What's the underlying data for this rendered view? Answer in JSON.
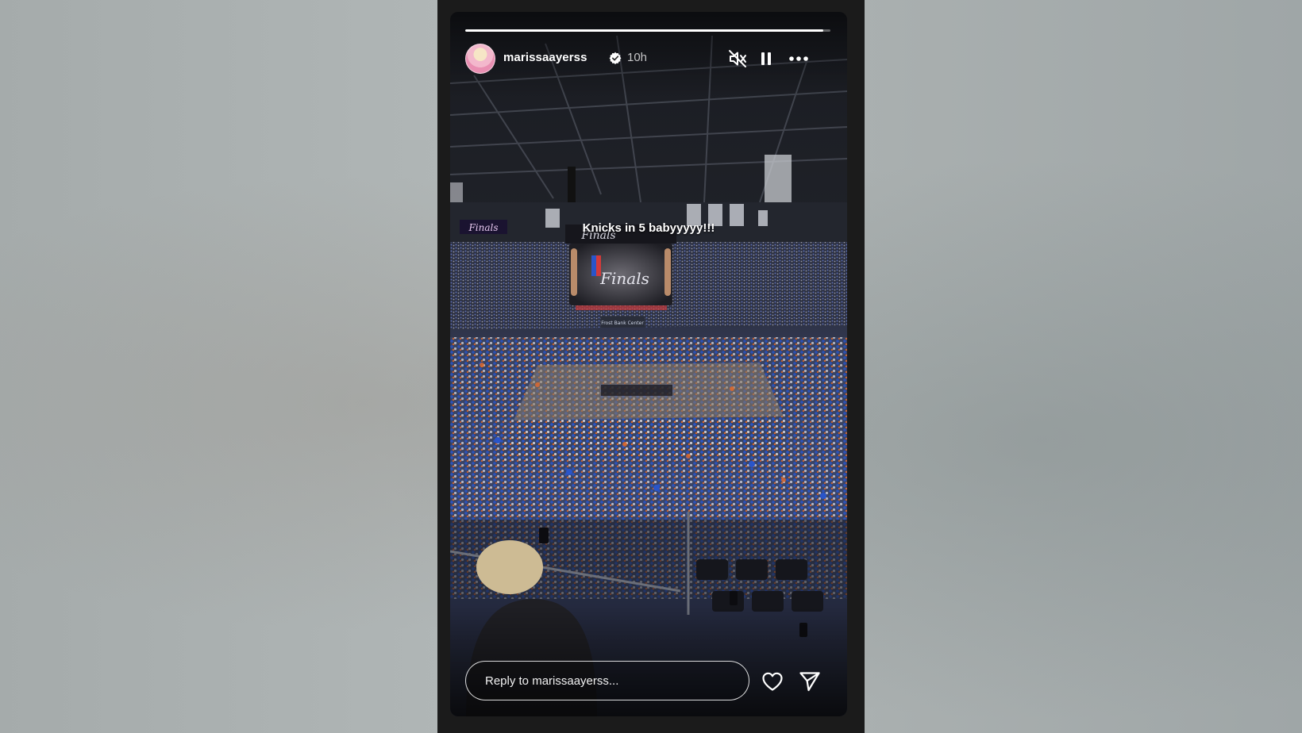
{
  "story": {
    "username": "marissaayerss",
    "verified": true,
    "time_ago": "10h",
    "progress": 0.98,
    "caption": "Knicks in 5 babyyyyy!!!",
    "reply_placeholder": "Reply to marissaayerss...",
    "scene": {
      "scoreboard_text": "Finals",
      "banner_text": "Finals",
      "arena_sign": "Frost Bank Center"
    }
  },
  "icons": {
    "avatar": "profile-photo",
    "verified": "verified-badge-icon",
    "mute": "speaker-muted-icon",
    "pause": "pause-icon",
    "more": "more-options-icon",
    "like": "heart-icon",
    "share": "send-icon"
  },
  "colors": {
    "frame": "#1b1b1b",
    "backdrop": "#a7adad",
    "verified_badge": "#ffffff",
    "crowd_blue": "#2a55c9",
    "crowd_orange": "#e36a2a"
  }
}
